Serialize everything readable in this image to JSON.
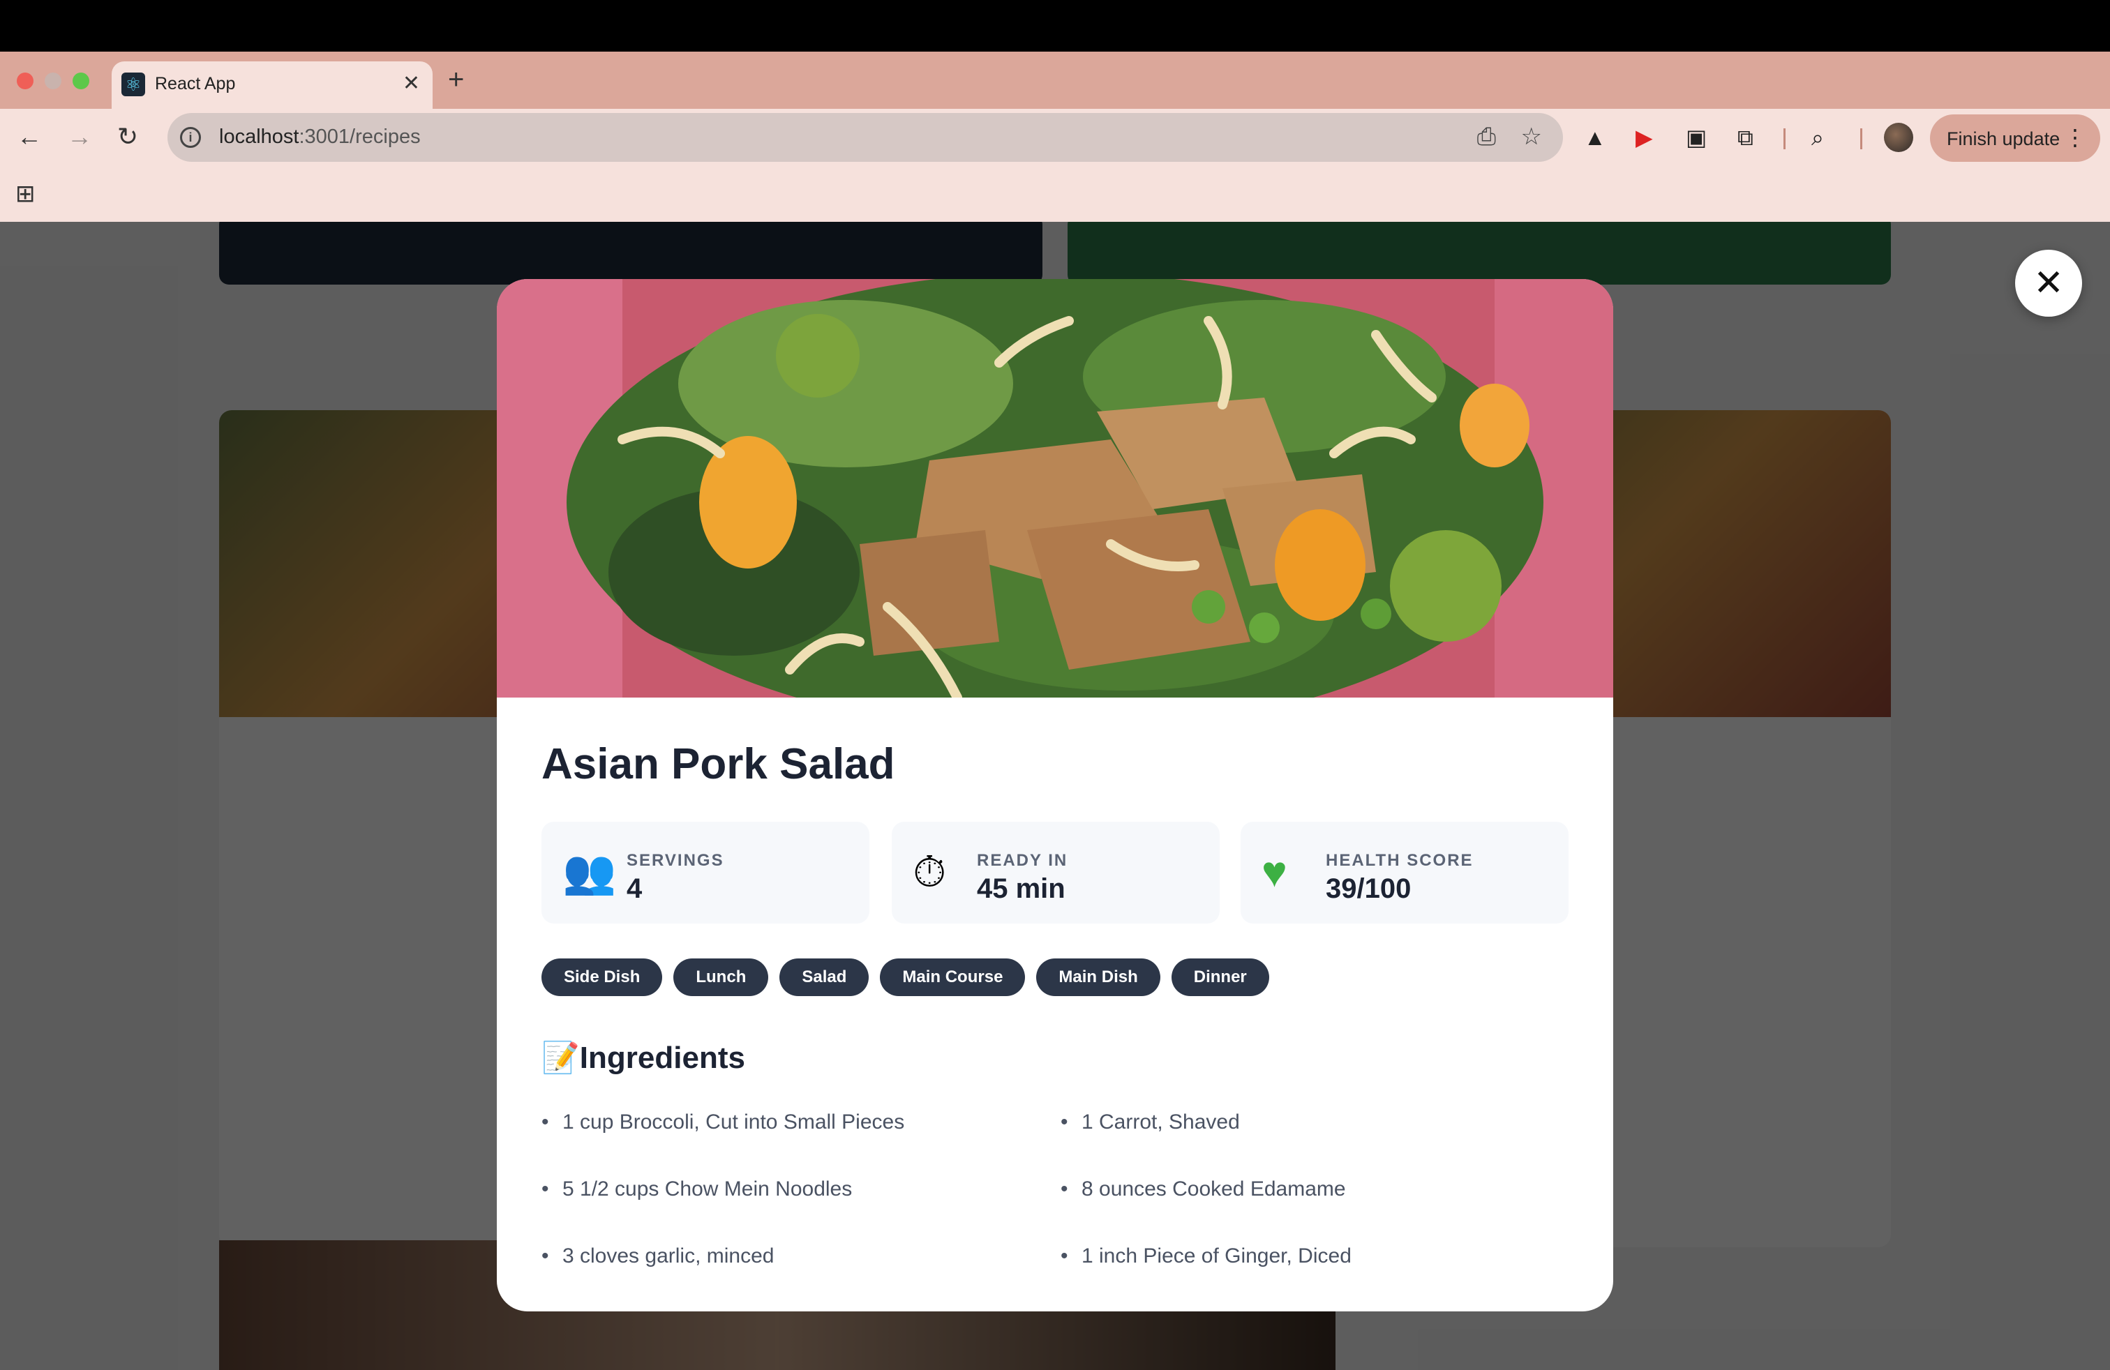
{
  "browser": {
    "tab_title": "React App",
    "tab_favicon": "react-atom-icon",
    "url_host": "localhost",
    "url_rest": ":3001/recipes",
    "finish_update_label": "Finish update"
  },
  "colors": {
    "tabstrip": "#dba79a",
    "chrome": "#f6e1dc",
    "tag_bg": "#2c3648",
    "title_text": "#1c2333",
    "stat_bg": "#f6f8fb"
  },
  "modal": {
    "title": "Asian Pork Salad",
    "stats": [
      {
        "icon": "people-icon",
        "label": "SERVINGS",
        "value": "4"
      },
      {
        "icon": "stopwatch-icon",
        "label": "READY IN",
        "value": "45 min"
      },
      {
        "icon": "green-heart-icon",
        "label": "HEALTH SCORE",
        "value": "39/100"
      }
    ],
    "tags": [
      "Side Dish",
      "Lunch",
      "Salad",
      "Main Course",
      "Main Dish",
      "Dinner"
    ],
    "ingredients_heading": "Ingredients",
    "ingredients": [
      "1 cup Broccoli, Cut into Small Pieces",
      "1 Carrot, Shaved",
      "5 1/2 cups Chow Mein Noodles",
      "8 ounces Cooked Edamame",
      "3 cloves garlic, minced",
      "1 inch Piece of Ginger, Diced"
    ]
  }
}
